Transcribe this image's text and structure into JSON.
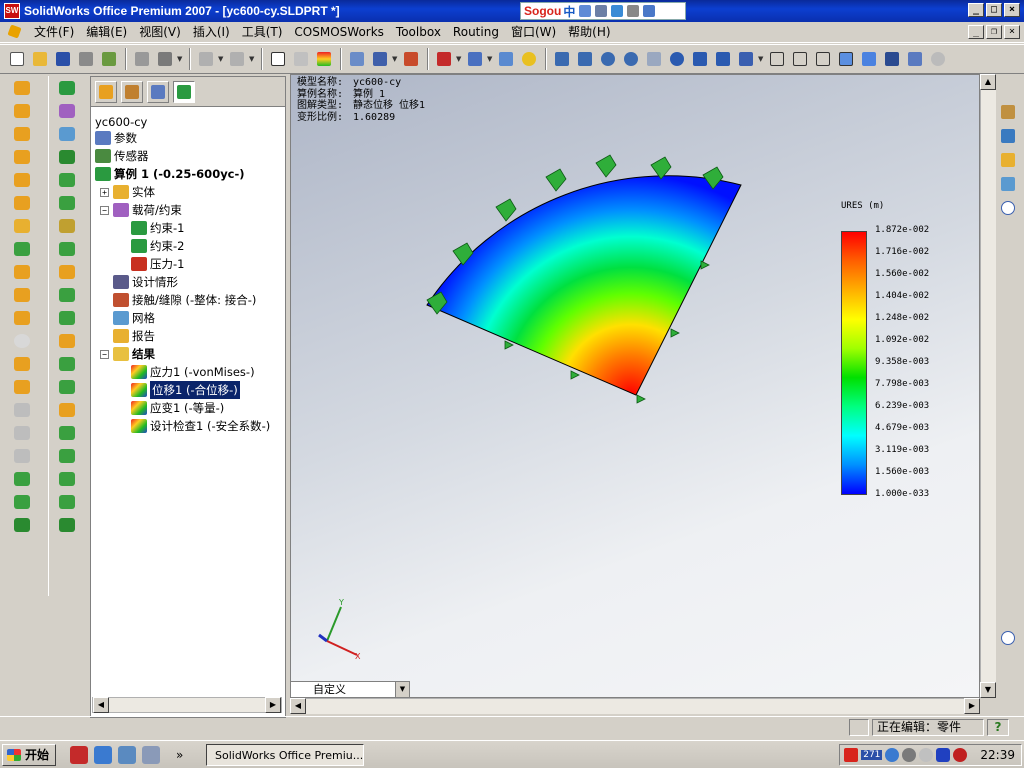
{
  "window": {
    "title": "SolidWorks Office Premium 2007 - [yc600-cy.SLDPRT *]",
    "logo_text": "SW",
    "ime": {
      "brand": "Sogou",
      "mode": "中"
    }
  },
  "menubar": {
    "items": [
      "文件(F)",
      "编辑(E)",
      "视图(V)",
      "插入(I)",
      "工具(T)",
      "COSMOSWorks",
      "Toolbox",
      "Routing",
      "窗口(W)",
      "帮助(H)"
    ]
  },
  "tree": {
    "root": "yc600-cy",
    "nodes": [
      {
        "label": "参数"
      },
      {
        "label": "传感器"
      },
      {
        "label": "算例 1 (-0.25-600yc-)"
      },
      {
        "label": "实体"
      },
      {
        "label": "载荷/约束"
      },
      {
        "label": "约束-1"
      },
      {
        "label": "约束-2"
      },
      {
        "label": "压力-1"
      },
      {
        "label": "设计情形"
      },
      {
        "label": "接触/缝隙 (-整体: 接合-)"
      },
      {
        "label": "网格"
      },
      {
        "label": "报告"
      },
      {
        "label": "结果"
      },
      {
        "label": "应力1 (-vonMises-)"
      },
      {
        "label": "位移1 (-合位移-)"
      },
      {
        "label": "应变1 (-等量-)"
      },
      {
        "label": "设计检查1 (-安全系数-)"
      }
    ]
  },
  "viewport": {
    "info": [
      {
        "key": "模型名称:",
        "value": "yc600-cy"
      },
      {
        "key": "算例名称:",
        "value": "算例 1"
      },
      {
        "key": "图解类型:",
        "value": "静态位移 位移1"
      },
      {
        "key": "变形比例:",
        "value": "1.60289"
      }
    ],
    "legend": {
      "title": "URES (m)",
      "values": [
        "1.872e-002",
        "1.716e-002",
        "1.560e-002",
        "1.404e-002",
        "1.248e-002",
        "1.092e-002",
        "9.358e-003",
        "7.798e-003",
        "6.239e-003",
        "4.679e-003",
        "3.119e-003",
        "1.560e-003",
        "1.000e-033"
      ],
      "gradient": [
        "#ff0000",
        "#ff6000",
        "#ffb000",
        "#ffff00",
        "#a0ff00",
        "#00e000",
        "#00ff80",
        "#00ffff",
        "#0090ff",
        "#0000ff"
      ]
    },
    "triad": {
      "x": "X",
      "y": "Y"
    },
    "view_combo": "自定义"
  },
  "status": {
    "editing": "正在编辑：零件",
    "help": "?"
  },
  "taskbar": {
    "start": "开始",
    "window_button": "SolidWorks Office Premiu...",
    "badge": "271",
    "clock": "22:39",
    "overflow": "»"
  }
}
